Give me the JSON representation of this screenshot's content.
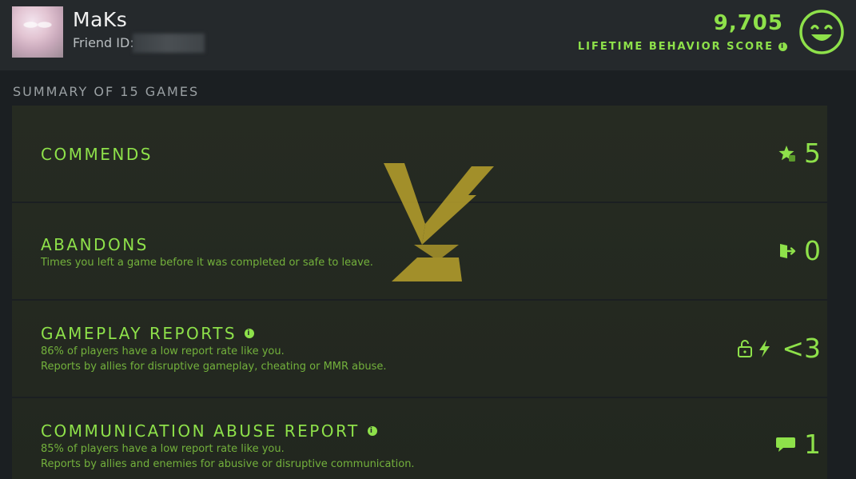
{
  "header": {
    "player_name": "MaKs",
    "friend_id_label": "Friend ID:",
    "behavior_score": "9,705",
    "behavior_score_label": "LIFETIME BEHAVIOR SCORE"
  },
  "summary": {
    "title": "SUMMARY OF 15 GAMES",
    "rows": [
      {
        "title": "COMMENDS",
        "desc1": "",
        "desc2": "",
        "value": "5",
        "icon": "star-commend-icon"
      },
      {
        "title": "ABANDONS",
        "desc1": "Times you left a game before it was completed or safe to leave.",
        "desc2": "",
        "value": "0",
        "icon": "exit-door-icon"
      },
      {
        "title": "GAMEPLAY REPORTS",
        "desc1": "86% of players have a low report rate like you.",
        "desc2": "Reports by allies for disruptive gameplay, cheating or MMR abuse.",
        "value": "<3",
        "icon": "lock-lightning-icon"
      },
      {
        "title": "COMMUNICATION ABUSE REPORT",
        "desc1": "85% of players have a low report rate like you.",
        "desc2": "Reports by allies and enemies for abusive or disruptive communication.",
        "value": "1",
        "icon": "chat-bubble-icon"
      }
    ]
  },
  "colors": {
    "accent": "#8ee14a",
    "accent_dim": "#73b13c",
    "emblem": "#b8a12c"
  }
}
